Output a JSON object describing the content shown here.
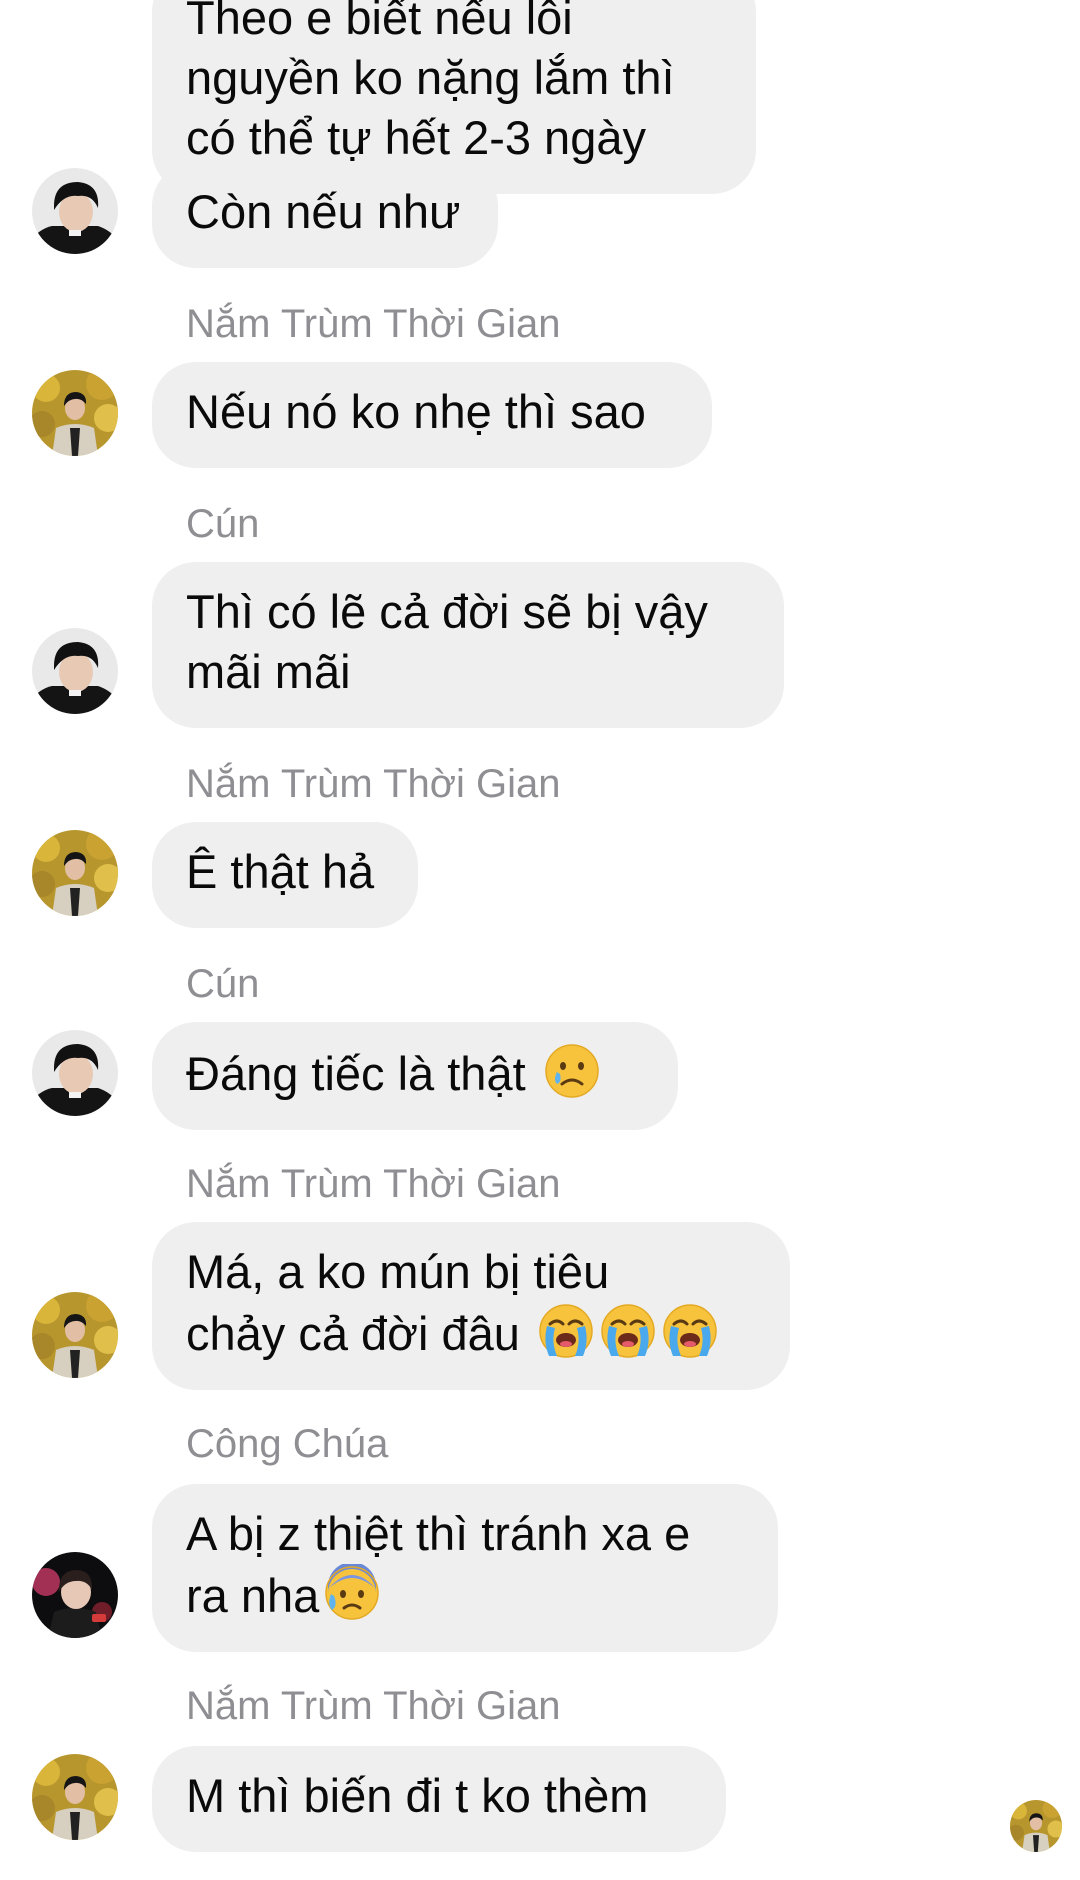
{
  "messages": [
    {
      "id": "m0",
      "sender": "",
      "lines": [
        "Theo e biết nếu lỗi",
        "nguyền ko nặng lắm thì",
        "có thể tự hết 2-3 ngày"
      ]
    },
    {
      "id": "m1",
      "sender": "",
      "lines": [
        "Còn nếu như"
      ]
    },
    {
      "id": "m2",
      "sender": "Nắm Trùm Thời Gian",
      "lines": [
        "Nếu nó ko nhẹ thì sao"
      ]
    },
    {
      "id": "m3",
      "sender": "Cún",
      "lines": [
        "Thì có lẽ cả đời sẽ bị vậy",
        "mãi mãi"
      ]
    },
    {
      "id": "m4",
      "sender": "Nắm Trùm Thời Gian",
      "lines": [
        "Ê thật hả"
      ]
    },
    {
      "id": "m5",
      "sender": "Cún",
      "lines": [
        "Đáng tiếc là thật"
      ],
      "emoji": [
        "crying-face"
      ]
    },
    {
      "id": "m6",
      "sender": "Nắm Trùm Thời Gian",
      "lines": [
        "Má, a ko mún bị tiêu",
        "chảy cả đời đâu"
      ],
      "emoji": [
        "loudly-crying-face",
        "loudly-crying-face",
        "loudly-crying-face"
      ]
    },
    {
      "id": "m7",
      "sender": "Công Chúa",
      "lines": [
        "A bị z thiệt thì tránh xa e",
        "ra nha"
      ],
      "emoji": [
        "anxious-face-with-sweat"
      ]
    },
    {
      "id": "m8",
      "sender": "Nắm Trùm Thời Gian",
      "lines": [
        "M thì biến đi t ko thèm"
      ]
    }
  ],
  "colors": {
    "bubble_bg": "#efefef",
    "sender_text": "#8e8e93",
    "message_text": "#0a0a0a",
    "background": "#ffffff"
  },
  "icons": {
    "read_receipt": "read-receipt-avatar"
  }
}
